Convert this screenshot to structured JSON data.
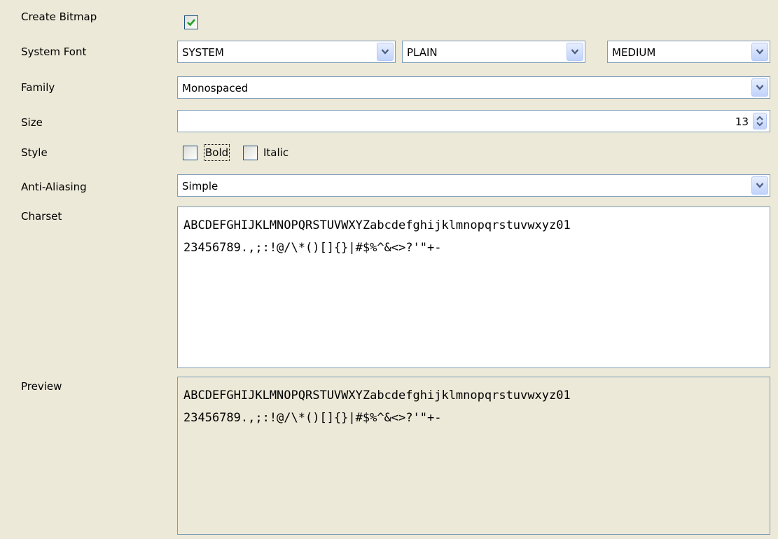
{
  "labels": {
    "create_bitmap": "Create Bitmap",
    "system_font": "System Font",
    "family": "Family",
    "size": "Size",
    "style": "Style",
    "anti_aliasing": "Anti-Aliasing",
    "charset": "Charset",
    "preview": "Preview"
  },
  "create_bitmap": {
    "checked": true
  },
  "system_font": {
    "font": "SYSTEM",
    "style": "PLAIN",
    "size": "MEDIUM"
  },
  "family": {
    "value": "Monospaced"
  },
  "size": {
    "value": "13"
  },
  "style": {
    "bold_label": "Bold",
    "italic_label": "Italic",
    "bold": false,
    "italic": false
  },
  "anti_aliasing": {
    "value": "Simple"
  },
  "charset": {
    "line1": "ABCDEFGHIJKLMNOPQRSTUVWXYZabcdefghijklmnopqrstuvwxyz01",
    "line2": "23456789.,;:!@/\\*()[]{}|#$%^&<>?'\"+-"
  },
  "preview": {
    "line1": "ABCDEFGHIJKLMNOPQRSTUVWXYZabcdefghijklmnopqrstuvwxyz01",
    "line2": "23456789.,;:!@/\\*()[]{}|#$%^&<>?'\"+-"
  },
  "colors": {
    "border": "#7f9db9",
    "panel_bg": "#ece9d8",
    "check_green": "#21a121"
  },
  "icons": {
    "dropdown": "chevron-down-icon",
    "spinner": "spinner-arrows-icon",
    "check": "checkmark-icon"
  }
}
